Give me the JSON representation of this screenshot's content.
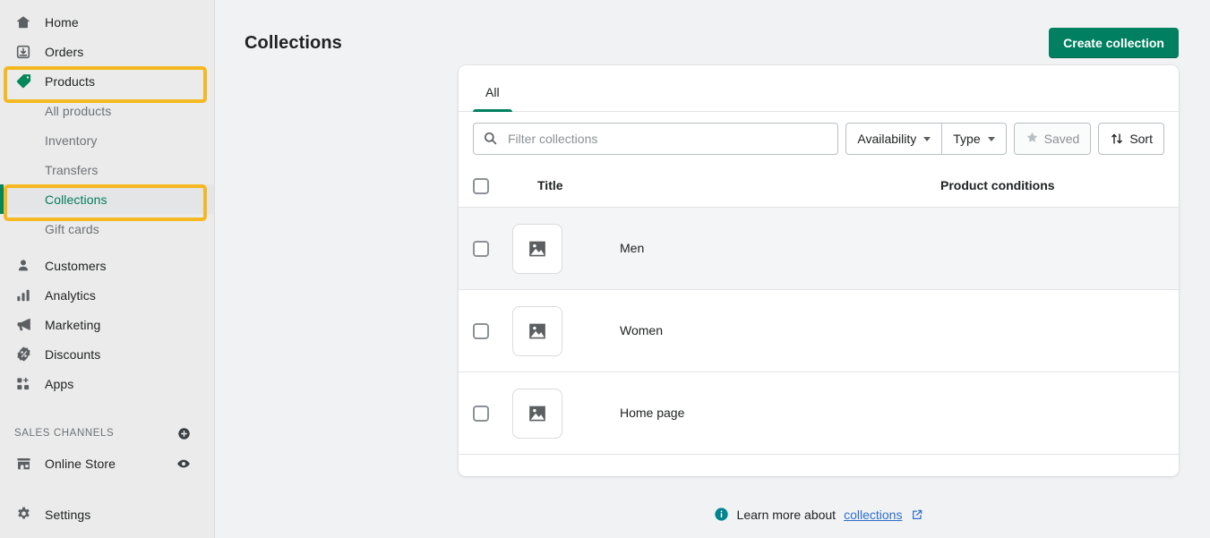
{
  "sidebar": {
    "items": [
      {
        "label": "Home",
        "icon": "home-icon"
      },
      {
        "label": "Orders",
        "icon": "orders-icon"
      },
      {
        "label": "Products",
        "icon": "tag-icon"
      },
      {
        "label": "Customers",
        "icon": "customer-icon"
      },
      {
        "label": "Analytics",
        "icon": "analytics-icon"
      },
      {
        "label": "Marketing",
        "icon": "megaphone-icon"
      },
      {
        "label": "Discounts",
        "icon": "discount-icon"
      },
      {
        "label": "Apps",
        "icon": "apps-icon"
      }
    ],
    "product_subitems": [
      {
        "label": "All products"
      },
      {
        "label": "Inventory"
      },
      {
        "label": "Transfers"
      },
      {
        "label": "Collections"
      },
      {
        "label": "Gift cards"
      }
    ],
    "sales_channels": {
      "title": "SALES CHANNELS",
      "add_icon": "plus-circle-icon",
      "channel": {
        "label": "Online Store",
        "icon": "store-icon",
        "view_icon": "eye-icon"
      }
    },
    "settings": {
      "label": "Settings",
      "icon": "gear-icon"
    },
    "highlight_color": "#f5b820",
    "active_color": "#007b5c"
  },
  "header": {
    "title": "Collections",
    "create_button": "Create collection"
  },
  "tabs": [
    {
      "label": "All",
      "active": true
    }
  ],
  "filters": {
    "search_placeholder": "Filter collections",
    "search_value": "",
    "search_icon": "search-icon",
    "availability": "Availability",
    "type": "Type",
    "saved": "Saved",
    "saved_icon": "star-icon",
    "sort": "Sort",
    "sort_icon": "sort-arrows-icon"
  },
  "table": {
    "columns": [
      "Title",
      "Product conditions"
    ],
    "rows": [
      {
        "title": "Men",
        "conditions": "",
        "thumb": "image-placeholder-icon",
        "highlighted": true
      },
      {
        "title": "Women",
        "conditions": "",
        "thumb": "image-placeholder-icon",
        "highlighted": false
      },
      {
        "title": "Home page",
        "conditions": "",
        "thumb": "image-placeholder-icon",
        "highlighted": false
      }
    ]
  },
  "footer": {
    "info_icon": "info-icon",
    "text": "Learn more about",
    "link": "collections",
    "external_icon": "external-link-icon"
  }
}
